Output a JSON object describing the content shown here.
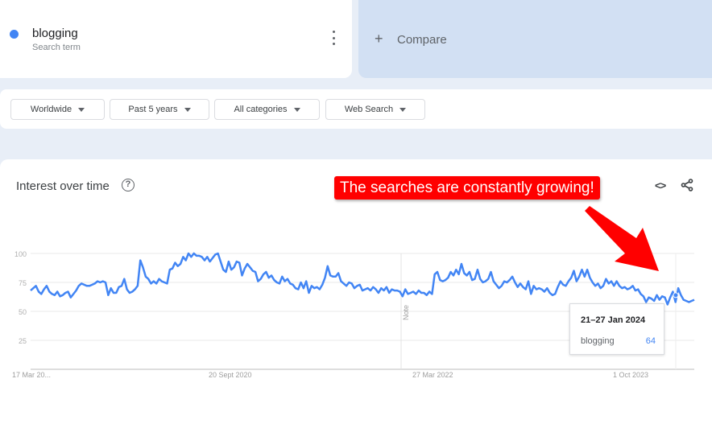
{
  "search_term": {
    "name": "blogging",
    "subtitle": "Search term",
    "color": "#4285f4"
  },
  "compare": {
    "plus": "+",
    "label": "Compare"
  },
  "filters": [
    {
      "label": "Worldwide"
    },
    {
      "label": "Past 5 years"
    },
    {
      "label": "All categories"
    },
    {
      "label": "Web Search"
    }
  ],
  "panel": {
    "title": "Interest over time",
    "help": "?",
    "embed_icon": "<>",
    "annotation": "The searches are constantly growing!",
    "annotation_color": "#ff0000"
  },
  "tooltip": {
    "date": "21–27 Jan 2024",
    "term": "blogging",
    "value": "64"
  },
  "chart_data": {
    "type": "line",
    "title": "Interest over time",
    "xlabel": "",
    "ylabel": "",
    "ylim": [
      0,
      100
    ],
    "yticks": [
      25,
      50,
      75,
      100
    ],
    "xtick_labels": [
      "17 Mar 20...",
      "20 Sept 2020",
      "27 Mar 2022",
      "1 Oct 2023"
    ],
    "note_label": "Note",
    "grid": true,
    "series": [
      {
        "name": "blogging",
        "color": "#4285f4",
        "values": [
          68,
          70,
          72,
          67,
          65,
          69,
          72,
          67,
          65,
          64,
          67,
          63,
          64,
          66,
          67,
          62,
          65,
          68,
          72,
          74,
          73,
          72,
          72,
          73,
          74,
          76,
          75,
          76,
          75,
          64,
          70,
          66,
          66,
          71,
          72,
          78,
          69,
          66,
          67,
          69,
          72,
          94,
          88,
          80,
          78,
          74,
          76,
          74,
          78,
          76,
          75,
          74,
          86,
          87,
          92,
          89,
          91,
          97,
          94,
          100,
          97,
          100,
          98,
          98,
          97,
          94,
          97,
          93,
          96,
          99,
          100,
          93,
          86,
          84,
          93,
          86,
          88,
          93,
          92,
          81,
          87,
          91,
          88,
          85,
          84,
          76,
          78,
          82,
          84,
          79,
          81,
          77,
          75,
          74,
          80,
          76,
          78,
          74,
          73,
          70,
          69,
          75,
          70,
          76,
          66,
          72,
          70,
          71,
          69,
          73,
          79,
          89,
          81,
          80,
          80,
          83,
          76,
          74,
          72,
          75,
          74,
          70,
          72,
          73,
          68,
          69,
          70,
          68,
          71,
          69,
          66,
          70,
          68,
          71,
          66,
          69,
          68,
          68,
          67,
          63,
          69,
          65,
          66,
          67,
          65,
          68,
          66,
          66,
          64,
          67,
          65,
          82,
          84,
          77,
          76,
          77,
          79,
          84,
          81,
          86,
          82,
          91,
          83,
          81,
          84,
          77,
          78,
          86,
          78,
          75,
          76,
          78,
          84,
          76,
          73,
          70,
          72,
          76,
          75,
          77,
          80,
          75,
          71,
          74,
          71,
          69,
          76,
          65,
          72,
          69,
          70,
          69,
          67,
          70,
          66,
          64,
          65,
          71,
          76,
          73,
          72,
          76,
          79,
          85,
          76,
          80,
          86,
          80,
          86,
          79,
          75,
          72,
          74,
          70,
          72,
          78,
          74,
          76,
          72,
          76,
          72,
          70,
          71,
          69,
          70,
          72,
          68,
          69,
          65,
          63,
          58,
          62,
          61,
          59,
          64,
          60,
          63,
          62,
          56,
          62,
          67,
          58,
          70,
          64,
          60,
          59,
          58,
          59,
          60
        ]
      }
    ]
  }
}
